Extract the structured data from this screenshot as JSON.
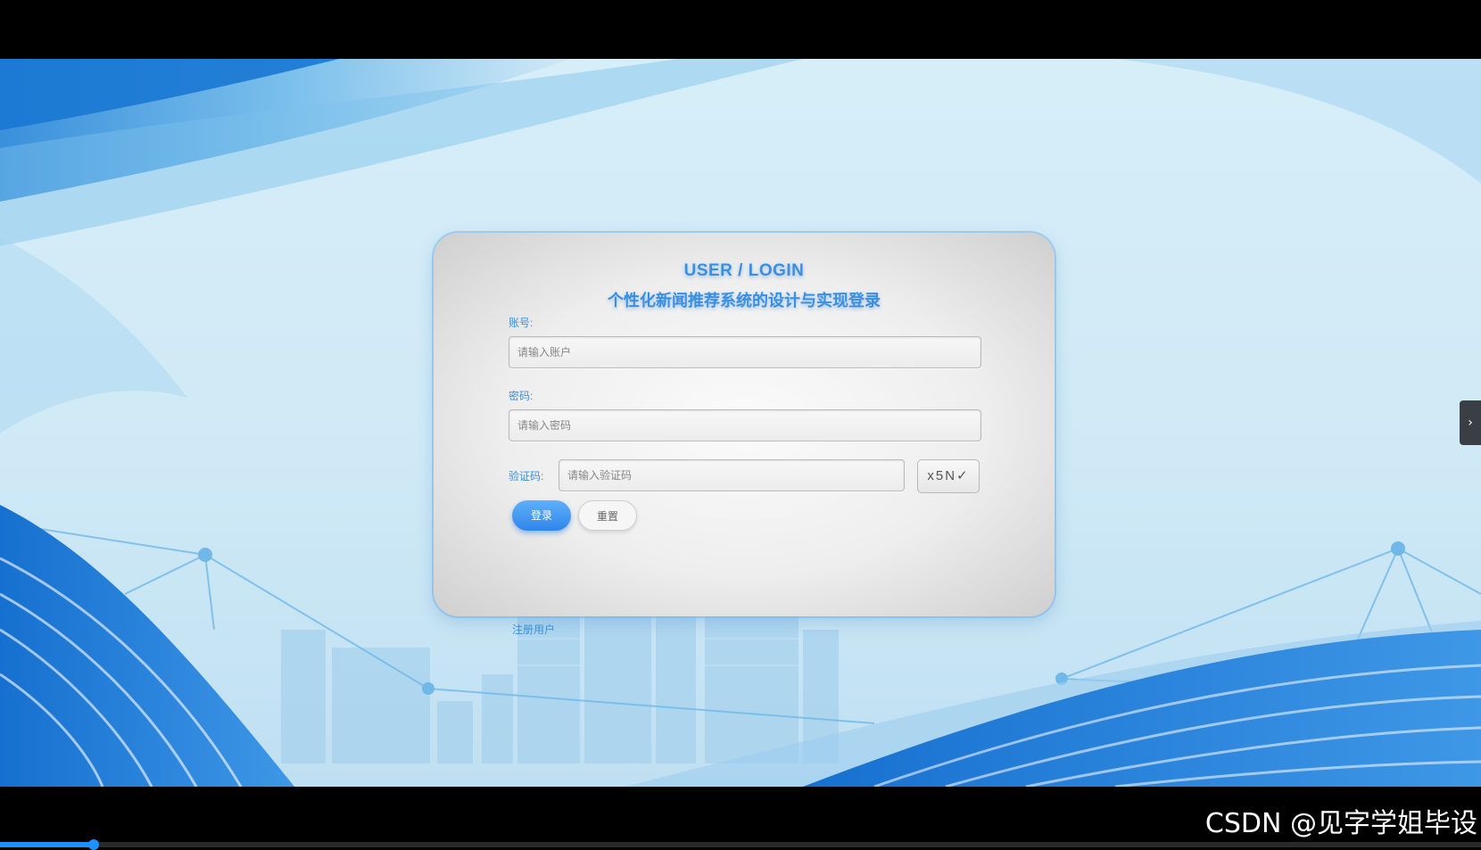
{
  "login": {
    "title_en": "USER / LOGIN",
    "title_zh": "个性化新闻推荐系统的设计与实现登录",
    "account_label": "账号:",
    "account_placeholder": "请输入账户",
    "password_label": "密码:",
    "password_placeholder": "请输入密码",
    "captcha_label": "验证码:",
    "captcha_placeholder": "请输入验证码",
    "captcha_text": "x5N✓",
    "login_button": "登录",
    "reset_button": "重置",
    "register_link": "注册用户"
  },
  "side_tab": {
    "icon": "chevron-right-icon",
    "glyph": "›"
  },
  "watermark": "CSDN @见字学姐毕设",
  "video": {
    "progress_fraction": 0.063
  },
  "colors": {
    "accent": "#3b8fe0",
    "button": "#2f86ea",
    "background": "#d6eef8"
  }
}
